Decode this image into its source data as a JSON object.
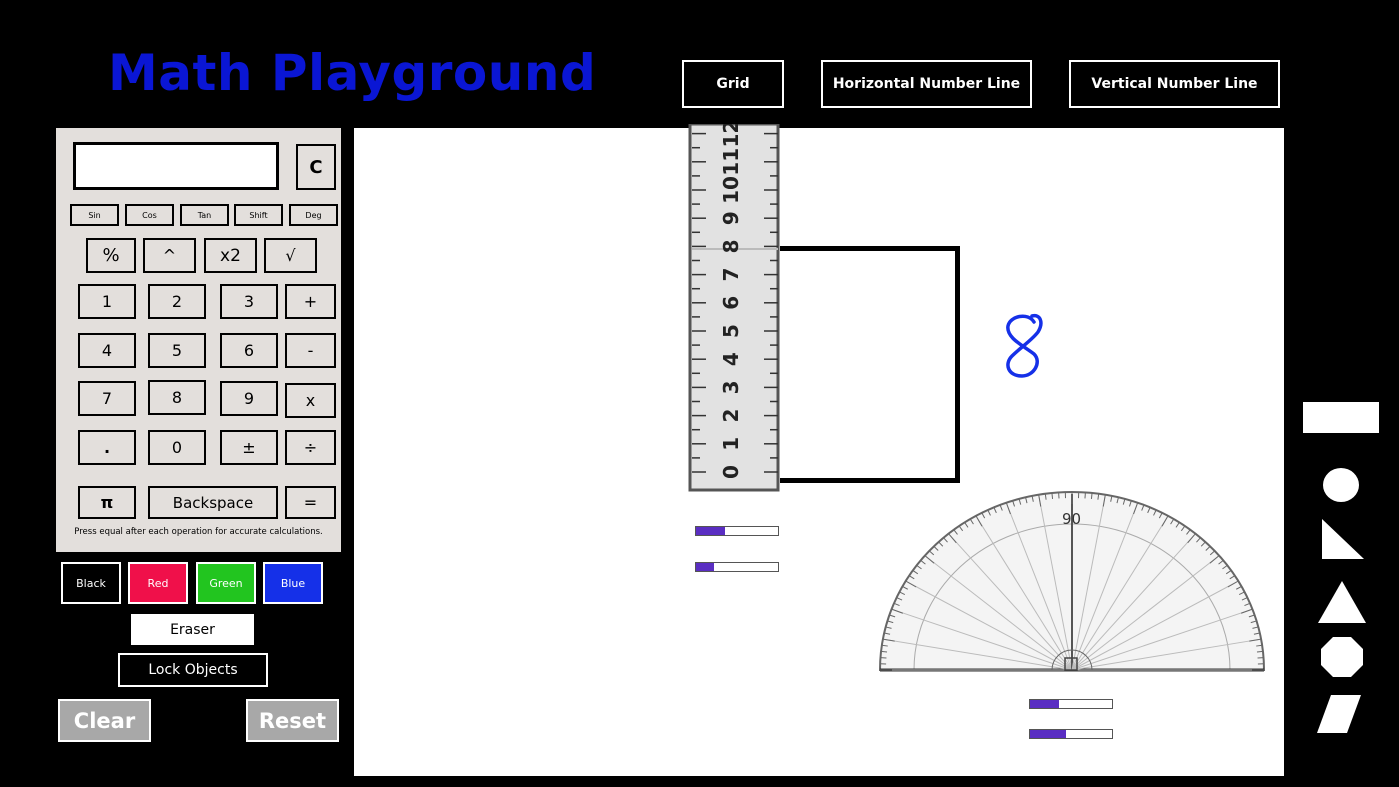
{
  "app": {
    "title": "Math Playground"
  },
  "toolbar": {
    "grid": "Grid",
    "horizontal": "Horizontal Number Line",
    "vertical": "Vertical Number Line"
  },
  "calculator": {
    "display": "",
    "clear": "C",
    "trig": [
      "Sin",
      "Cos",
      "Tan",
      "Shift",
      "Deg"
    ],
    "ops": [
      "%",
      "^",
      "x2",
      "√"
    ],
    "rows": [
      [
        "1",
        "2",
        "3",
        "+"
      ],
      [
        "4",
        "5",
        "6",
        "-"
      ],
      [
        "7",
        "8",
        "9",
        "x"
      ],
      [
        ".",
        "0",
        "±",
        "÷"
      ]
    ],
    "bottom": [
      "π",
      "Backspace",
      "="
    ],
    "hint": "Press equal after each operation for accurate calculations."
  },
  "colors": {
    "black": {
      "label": "Black",
      "hex": "#000000"
    },
    "red": {
      "label": "Red",
      "hex": "#f0104a"
    },
    "green": {
      "label": "Green",
      "hex": "#22c51f"
    },
    "blue": {
      "label": "Blue",
      "hex": "#1530e8"
    }
  },
  "actions": {
    "eraser": "Eraser",
    "lock": "Lock Objects",
    "clear": "Clear",
    "reset": "Reset"
  },
  "canvas": {
    "handwriting": "8",
    "ruler_numbers": [
      "0",
      "1",
      "2",
      "3",
      "4",
      "5",
      "6",
      "7",
      "8",
      "9",
      "10",
      "11",
      "12"
    ],
    "protractor_center_label": "90",
    "sliders": [
      {
        "name": "ruler-slider-1",
        "value": 0.35
      },
      {
        "name": "ruler-slider-2",
        "value": 0.22
      },
      {
        "name": "protractor-slider-1",
        "value": 0.35
      },
      {
        "name": "protractor-slider-2",
        "value": 0.44
      }
    ]
  },
  "shapes": [
    "rectangle-shape",
    "circle-shape",
    "right-triangle-shape",
    "triangle-shape",
    "octagon-shape",
    "parallelogram-shape"
  ]
}
